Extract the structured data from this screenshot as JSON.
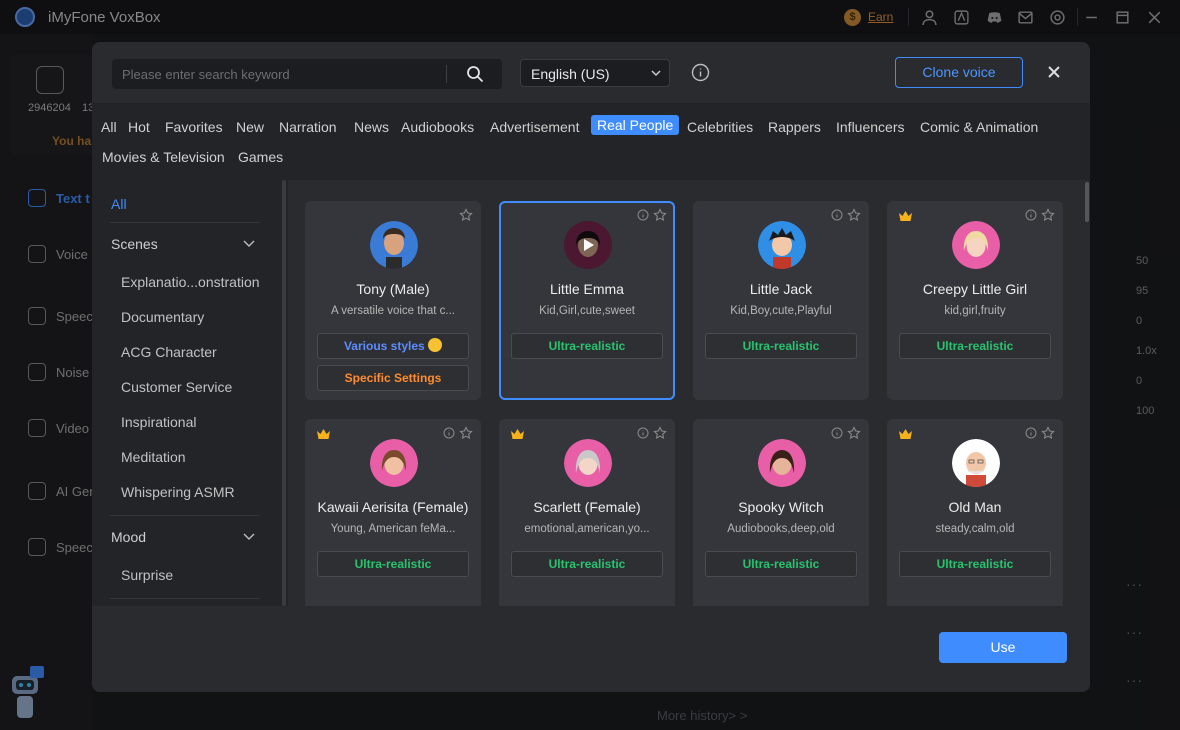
{
  "app": {
    "title": "iMyFone VoxBox",
    "earn_label": "Earn"
  },
  "background": {
    "credit_value": "2946204",
    "credit_value_2": "13",
    "warning_text": "You ha",
    "nav": [
      "Text t",
      "Voice",
      "Speec",
      "Noise",
      "Video",
      "AI Ger",
      "Speech"
    ],
    "right_values": [
      "50",
      "95",
      "0",
      "1.0x",
      "0",
      "100"
    ],
    "more_history": "More history> >"
  },
  "search": {
    "placeholder": "Please enter search keyword",
    "value": ""
  },
  "language": {
    "selected": "English (US)"
  },
  "clone_voice_label": "Clone voice",
  "categories": [
    "All",
    "Hot",
    "Favorites",
    "New",
    "Narration",
    "News",
    "Audiobooks",
    "Advertisement",
    "Real People",
    "Celebrities",
    "Rappers",
    "Influencers",
    "Comic & Animation",
    "Movies & Television",
    "Games"
  ],
  "active_category": "Real People",
  "left_panel": {
    "all_label": "All",
    "scenes_label": "Scenes",
    "scenes": [
      "Explanatio...onstration",
      "Documentary",
      "ACG Character",
      "Customer Service",
      "Inspirational",
      "Meditation",
      "Whispering ASMR"
    ],
    "mood_label": "Mood",
    "moods": [
      "Surprise"
    ]
  },
  "voices": [
    {
      "name": "Tony (Male)",
      "desc": "A versatile voice that c...",
      "badges": [
        {
          "label": "Various styles",
          "color": "#5c8dff"
        },
        {
          "label": "Specific Settings",
          "color": "#ff8b2c"
        }
      ],
      "premium": false,
      "selected": false,
      "avatar_color": "#3a7bd5"
    },
    {
      "name": "Little Emma",
      "desc": "Kid,Girl,cute,sweet",
      "badges": [
        {
          "label": "Ultra-realistic",
          "color": "#27c36e"
        }
      ],
      "premium": false,
      "selected": true,
      "avatar_color": "#8a2a5a"
    },
    {
      "name": "Little Jack",
      "desc": "Kid,Boy,cute,Playful",
      "badges": [
        {
          "label": "Ultra-realistic",
          "color": "#27c36e"
        }
      ],
      "premium": false,
      "selected": false,
      "avatar_color": "#2f8fe6"
    },
    {
      "name": "Creepy Little Girl",
      "desc": "kid,girl,fruity",
      "badges": [
        {
          "label": "Ultra-realistic",
          "color": "#27c36e"
        }
      ],
      "premium": true,
      "selected": false,
      "avatar_color": "#e85fa8"
    },
    {
      "name": "Kawaii Aerisita (Female)",
      "desc": "Young, American feMa...",
      "badges": [
        {
          "label": "Ultra-realistic",
          "color": "#27c36e"
        }
      ],
      "premium": true,
      "selected": false,
      "avatar_color": "#e85fa8"
    },
    {
      "name": "Scarlett (Female)",
      "desc": "emotional,american,yo...",
      "badges": [
        {
          "label": "Ultra-realistic",
          "color": "#27c36e"
        }
      ],
      "premium": true,
      "selected": false,
      "avatar_color": "#e85fa8"
    },
    {
      "name": "Spooky Witch",
      "desc": "Audiobooks,deep,old",
      "badges": [
        {
          "label": "Ultra-realistic",
          "color": "#27c36e"
        }
      ],
      "premium": false,
      "selected": false,
      "avatar_color": "#e85fa8"
    },
    {
      "name": "Old Man",
      "desc": "steady,calm,old",
      "badges": [
        {
          "label": "Ultra-realistic",
          "color": "#27c36e"
        }
      ],
      "premium": true,
      "selected": false,
      "avatar_color": "#ffffff"
    }
  ],
  "use_label": "Use",
  "colors": {
    "accent": "#3f8cff",
    "ultra": "#27c36e",
    "styles": "#5c8dff",
    "settings": "#ff8b2c",
    "crown": "#f5b21b"
  }
}
